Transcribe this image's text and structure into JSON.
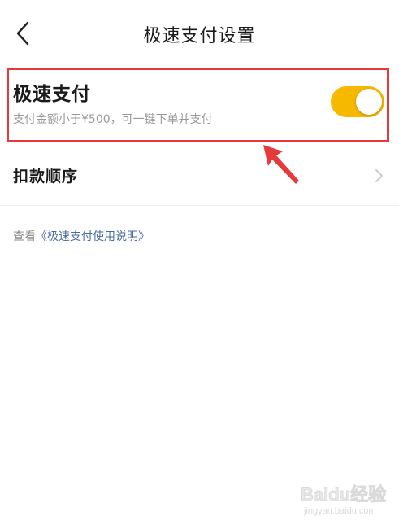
{
  "header": {
    "title": "极速支付设置"
  },
  "speed_pay": {
    "title": "极速支付",
    "description": "支付金额小于¥500，可一键下单并支付",
    "enabled": true,
    "toggle_color": "#f7b800"
  },
  "payment_order": {
    "label": "扣款顺序"
  },
  "help": {
    "prefix": "查看",
    "link_text": "《极速支付使用说明》"
  },
  "watermark": {
    "brand": "Baidu经验",
    "url": "jingyan.baidu.com"
  },
  "annotation": {
    "highlight_color": "#e6393a"
  }
}
